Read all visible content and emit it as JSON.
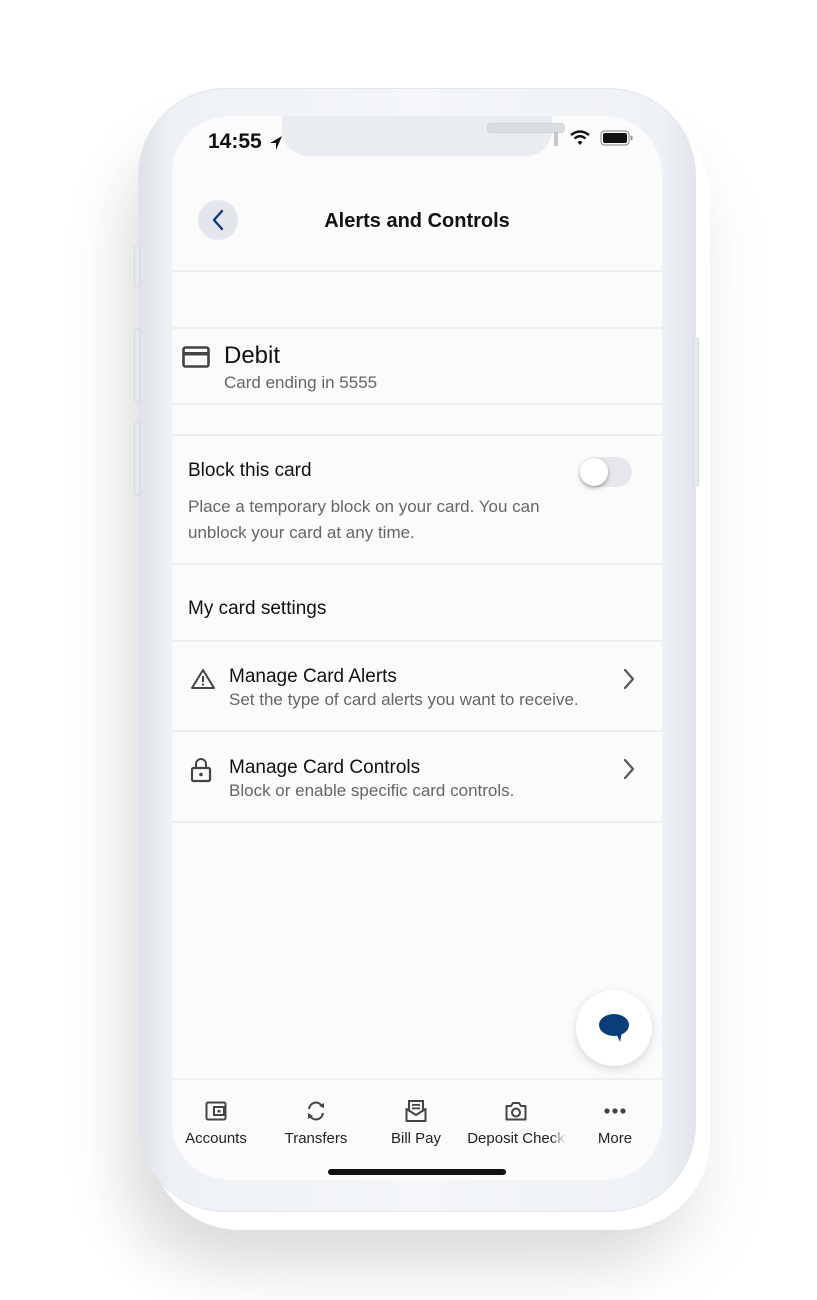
{
  "status_bar": {
    "time": "14:55"
  },
  "header": {
    "title": "Alerts and Controls",
    "back_icon": "chevron-left-icon"
  },
  "card": {
    "icon": "credit-card-icon",
    "name": "Debit",
    "subtitle": "Card ending in 5555"
  },
  "block_card": {
    "title": "Block this card",
    "description": "Place a temporary block on your card. You can unblock your card at any time.",
    "enabled": false
  },
  "settings": {
    "title": "My card settings",
    "items": [
      {
        "icon": "warning-triangle-icon",
        "title": "Manage Card Alerts",
        "subtitle": "Set the type of card alerts you want to receive."
      },
      {
        "icon": "lock-icon",
        "title": "Manage Card Controls",
        "subtitle": "Block or enable specific card controls."
      }
    ]
  },
  "chat": {
    "icon": "chat-bubble-icon"
  },
  "tabbar": {
    "items": [
      {
        "label": "Accounts",
        "icon": "wallet-icon"
      },
      {
        "label": "Transfers",
        "icon": "transfer-icon"
      },
      {
        "label": "Bill Pay",
        "icon": "bill-icon"
      },
      {
        "label": "Deposit Check",
        "icon": "camera-icon"
      },
      {
        "label": "More",
        "icon": "more-icon"
      }
    ]
  },
  "colors": {
    "accent": "#0b3d7a",
    "text": "#111111",
    "muted": "#666666"
  }
}
